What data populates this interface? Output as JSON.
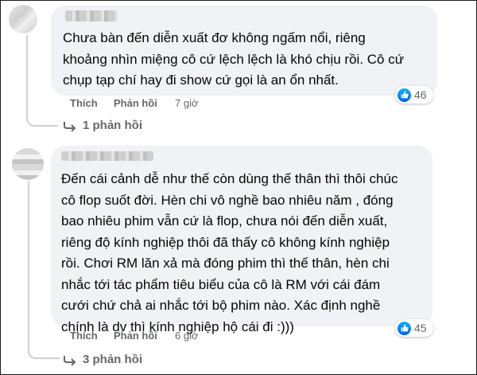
{
  "comments": [
    {
      "text_lines": [
        "Chưa bàn đến diễn xuất đơ không ngấm nổi, riêng",
        "khoảng nhìn miệng cô cứ lệch lệch là khó chịu rồi. Cô cứ",
        "chụp tạp chí hay đi show cứ gọi là an ổn nhất."
      ],
      "like_label": "Thích",
      "reply_label": "Phản hồi",
      "time": "7 giờ",
      "reaction_count": "46",
      "replies_label": "1 phản hồi"
    },
    {
      "text_lines": [
        "Đến cái cảnh dễ như thế còn dùng thế thân thì thôi chúc",
        "cô flop suốt đời. Hèn chi vô nghề bao nhiêu năm , đóng",
        "bao nhiêu phim vẫn cứ là flop, chưa nói đến diễn xuất,",
        "riêng độ kính nghiệp thôi đã thấy cô không kính nghiệp",
        "rồi. Chơi RM lăn xả mà đóng phim thì thế thân, hèn chi",
        "nhắc tới tác phẩm tiêu biểu của cô là RM với cái đám",
        "cưới chứ chả ai nhắc tới bộ phim nào. Xác định nghề",
        "chính là dv thì kính nghiệp hộ cái đi :)))"
      ],
      "like_label": "Thích",
      "reply_label": "Phản hồi",
      "time": "6 giờ",
      "reaction_count": "45",
      "replies_label": "3 phản hồi"
    }
  ],
  "colors": {
    "bubble": "#f0f2f5",
    "secondary_text": "#65676b",
    "like_blue": "#0866ff"
  },
  "icons": [
    "like-icon",
    "reply-arrow-icon",
    "avatar"
  ]
}
